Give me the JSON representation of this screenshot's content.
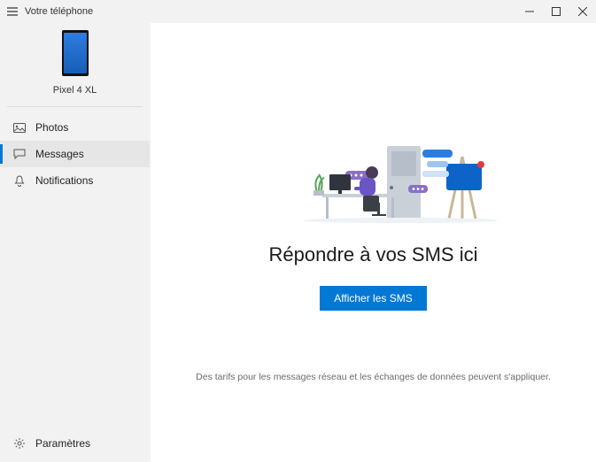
{
  "titlebar": {
    "app_title": "Votre téléphone"
  },
  "sidebar": {
    "device_name": "Pixel 4 XL",
    "nav": {
      "photos": {
        "label": "Photos",
        "icon": "photo-icon"
      },
      "messages": {
        "label": "Messages",
        "icon": "message-icon",
        "active": true
      },
      "notifications": {
        "label": "Notifications",
        "icon": "bell-icon"
      }
    },
    "settings_label": "Paramètres"
  },
  "main": {
    "headline": "Répondre à vos SMS ici",
    "button_label": "Afficher les SMS",
    "disclaimer": "Des tarifs pour les messages réseau et les échanges de données peuvent s'appliquer."
  },
  "colors": {
    "accent": "#0078d4"
  }
}
